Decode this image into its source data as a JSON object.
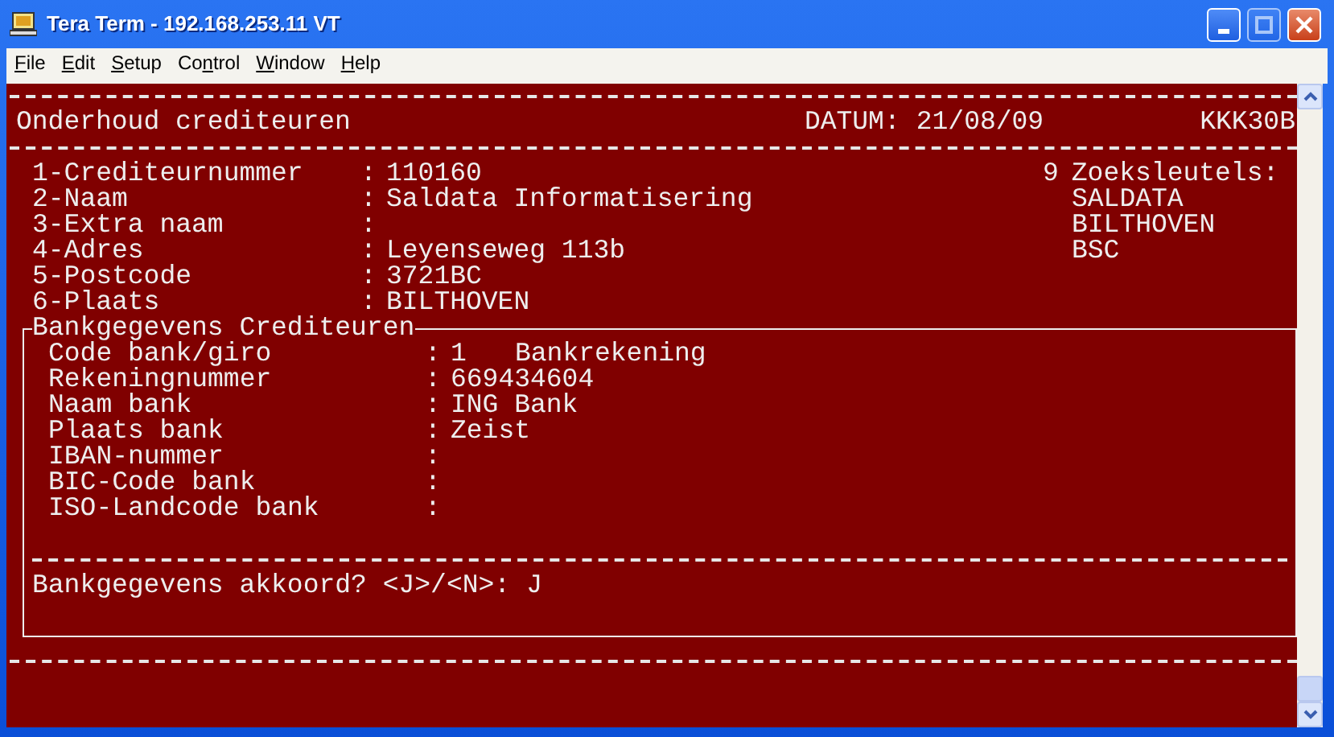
{
  "window": {
    "title": "Tera Term - 192.168.253.11 VT"
  },
  "menu": [
    {
      "key": "F",
      "after": "ile"
    },
    {
      "key": "E",
      "after": "dit"
    },
    {
      "key": "S",
      "after": "etup"
    },
    {
      "before": "Co",
      "key": "n",
      "after": "trol"
    },
    {
      "key": "W",
      "after": "indow"
    },
    {
      "key": "H",
      "after": "elp"
    }
  ],
  "terminal": {
    "header": {
      "title": "Onderhoud crediteuren",
      "date_label": "DATUM:",
      "date": "21/08/09",
      "program": "KKK30B"
    },
    "fields": [
      {
        "label": "1-Crediteurnummer",
        "separator": ":",
        "value": "110160"
      },
      {
        "label": "2-Naam",
        "separator": ":",
        "value": "Saldata Informatisering"
      },
      {
        "label": "3-Extra naam",
        "separator": ":"
      },
      {
        "label": "4-Adres",
        "separator": ":",
        "value": "Leyenseweg 113b"
      },
      {
        "label": "5-Postcode",
        "separator": ":",
        "value": "3721BC"
      },
      {
        "label": "6-Plaats",
        "separator": ":",
        "value": "BILTHOVEN"
      }
    ],
    "search_keys": {
      "count": "9",
      "label": "Zoeksleutels:",
      "keys": [
        "SALDATA",
        "BILTHOVEN",
        "BSC"
      ]
    },
    "bank": {
      "title": "Bankgegevens Crediteuren",
      "fields": [
        {
          "label": "Code bank/giro",
          "separator": ":",
          "value": "1",
          "description": "Bankrekening"
        },
        {
          "label": "Rekeningnummer",
          "separator": ":",
          "value": "669434604"
        },
        {
          "label": "Naam bank",
          "separator": ":",
          "value": "ING Bank"
        },
        {
          "label": "Plaats bank",
          "separator": ":",
          "value": "Zeist"
        },
        {
          "label": "IBAN-nummer",
          "separator": ":"
        },
        {
          "label": "BIC-Code bank",
          "separator": ":"
        },
        {
          "label": "ISO-Landcode bank",
          "separator": ":"
        }
      ],
      "prompt": "Bankgegevens akkoord? <J>/<N>:",
      "answer": "J"
    }
  }
}
